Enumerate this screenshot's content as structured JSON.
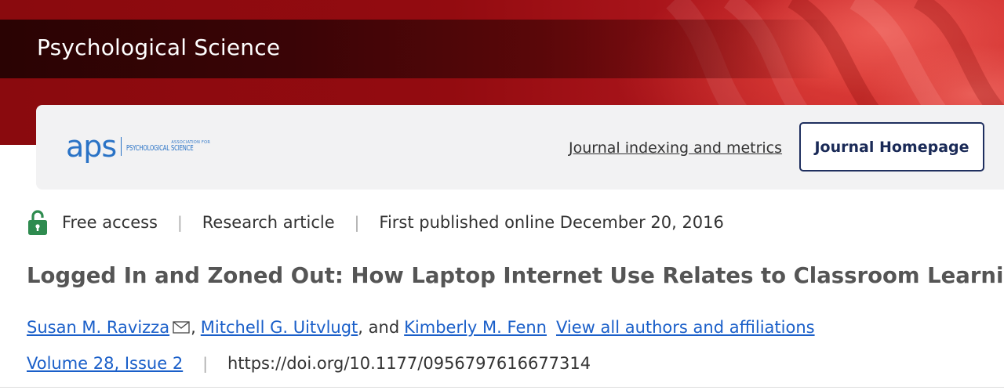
{
  "journal": {
    "title": "Psychological Science"
  },
  "header": {
    "logo_mark": "aps",
    "logo_small": "ASSOCIATION FOR",
    "logo_big": "PSYCHOLOGICAL SCIENCE",
    "indexing_link": "Journal indexing and metrics",
    "homepage_button": "Journal Homepage"
  },
  "meta": {
    "access": "Free access",
    "type": "Research article",
    "published": "First published online December 20, 2016"
  },
  "article": {
    "title": "Logged In and Zoned Out: How Laptop Internet Use Relates to Classroom Learning",
    "authors": [
      "Susan M. Ravizza",
      "Mitchell G. Uitvlugt",
      "Kimberly M. Fenn"
    ],
    "author_sep_1": ",",
    "author_sep_2": ", and",
    "view_all": "View all authors and affiliations",
    "issue": "Volume 28, Issue 2",
    "doi": "https://doi.org/10.1177/0956797616677314"
  },
  "colors": {
    "brand_red": "#930b10",
    "link_blue": "#1a5fc9",
    "aps_blue": "#2a73c6",
    "lock_green": "#2e8b4f"
  },
  "icons": {
    "lock": "open-lock-icon",
    "mail": "envelope-icon"
  }
}
